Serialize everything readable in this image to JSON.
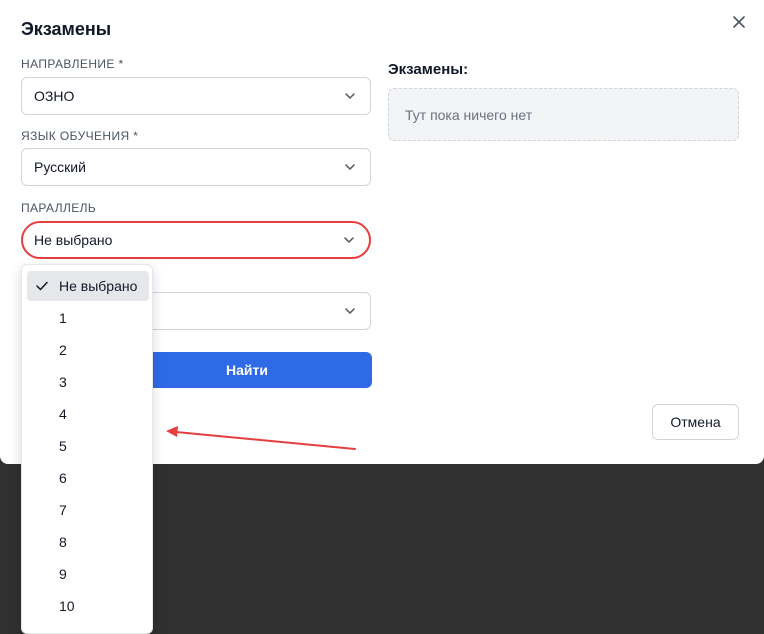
{
  "modal": {
    "title": "Экзамены",
    "close_icon": "close-icon"
  },
  "form": {
    "direction": {
      "label": "НАПРАВЛЕНИЕ *",
      "value": "ОЗНО"
    },
    "language": {
      "label": "ЯЗЫК ОБУЧЕНИЯ *",
      "value": "Русский"
    },
    "parallel": {
      "label": "ПАРАЛЛЕЛЬ",
      "value": "Не выбрано"
    },
    "search_label": "Найти"
  },
  "exams": {
    "title": "Экзамены:",
    "empty_text": "Тут пока ничего нет"
  },
  "cancel_label": "Отмена",
  "dropdown": {
    "items": [
      "Не выбрано",
      "1",
      "2",
      "3",
      "4",
      "5",
      "6",
      "7",
      "8",
      "9",
      "10"
    ],
    "selected_index": 0
  },
  "colors": {
    "primary": "#2f6ae6",
    "focus_ring": "#e53e3e",
    "annotation_arrow": "#e53e3e"
  }
}
